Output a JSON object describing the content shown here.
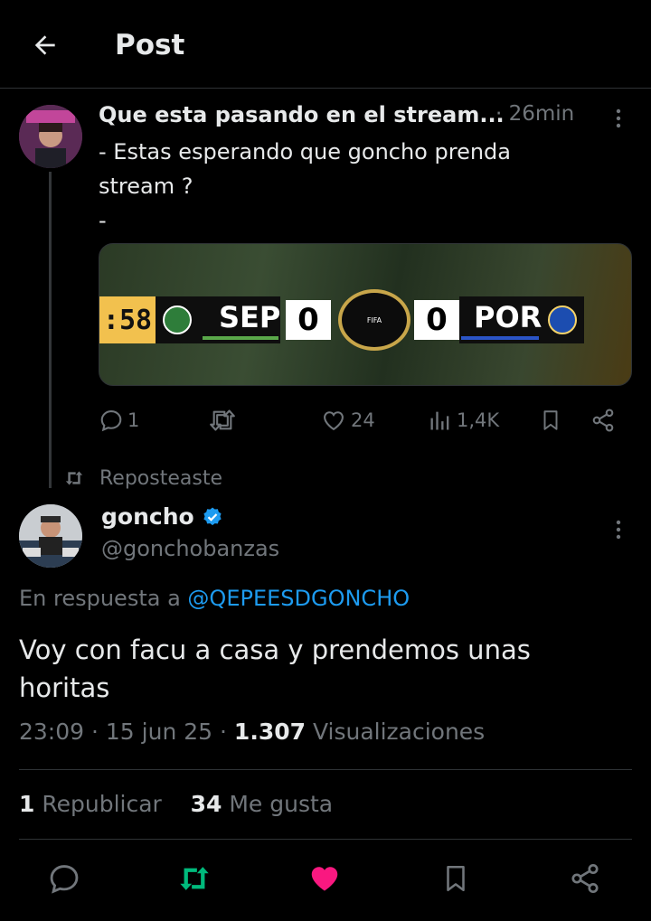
{
  "header": {
    "title": "Post"
  },
  "parent_post": {
    "author_name": "Que esta pasando en el stream...",
    "time": "· 26min",
    "text": "- Estas esperando que goncho prenda\nstream ?\n-",
    "media": {
      "clock": ":58",
      "home_abbr": "SEP",
      "home_score": "0",
      "away_score": "0",
      "away_abbr": "POR",
      "logo_text": "FIFA"
    },
    "replies": "1",
    "reposts": "",
    "likes": "24",
    "views": "1,4K"
  },
  "repost_notice": "Reposteaste",
  "main_post": {
    "author_name": "goncho",
    "handle": "@gonchobanzas",
    "reply_prefix": "En respuesta a",
    "reply_mention": "@QEPEESDGONCHO",
    "text": "Voy con facu a casa y prendemos unas horitas",
    "time": "23:09",
    "date": "15 jun 25",
    "views_count": "1.307",
    "views_label": "Visualizaciones",
    "reposts_count": "1",
    "reposts_label": "Republicar",
    "likes_count": "34",
    "likes_label": "Me gusta"
  },
  "colors": {
    "accent": "#1d9bf0",
    "repost_active": "#00ba7c",
    "like_active": "#f91880",
    "muted": "#71767b"
  }
}
